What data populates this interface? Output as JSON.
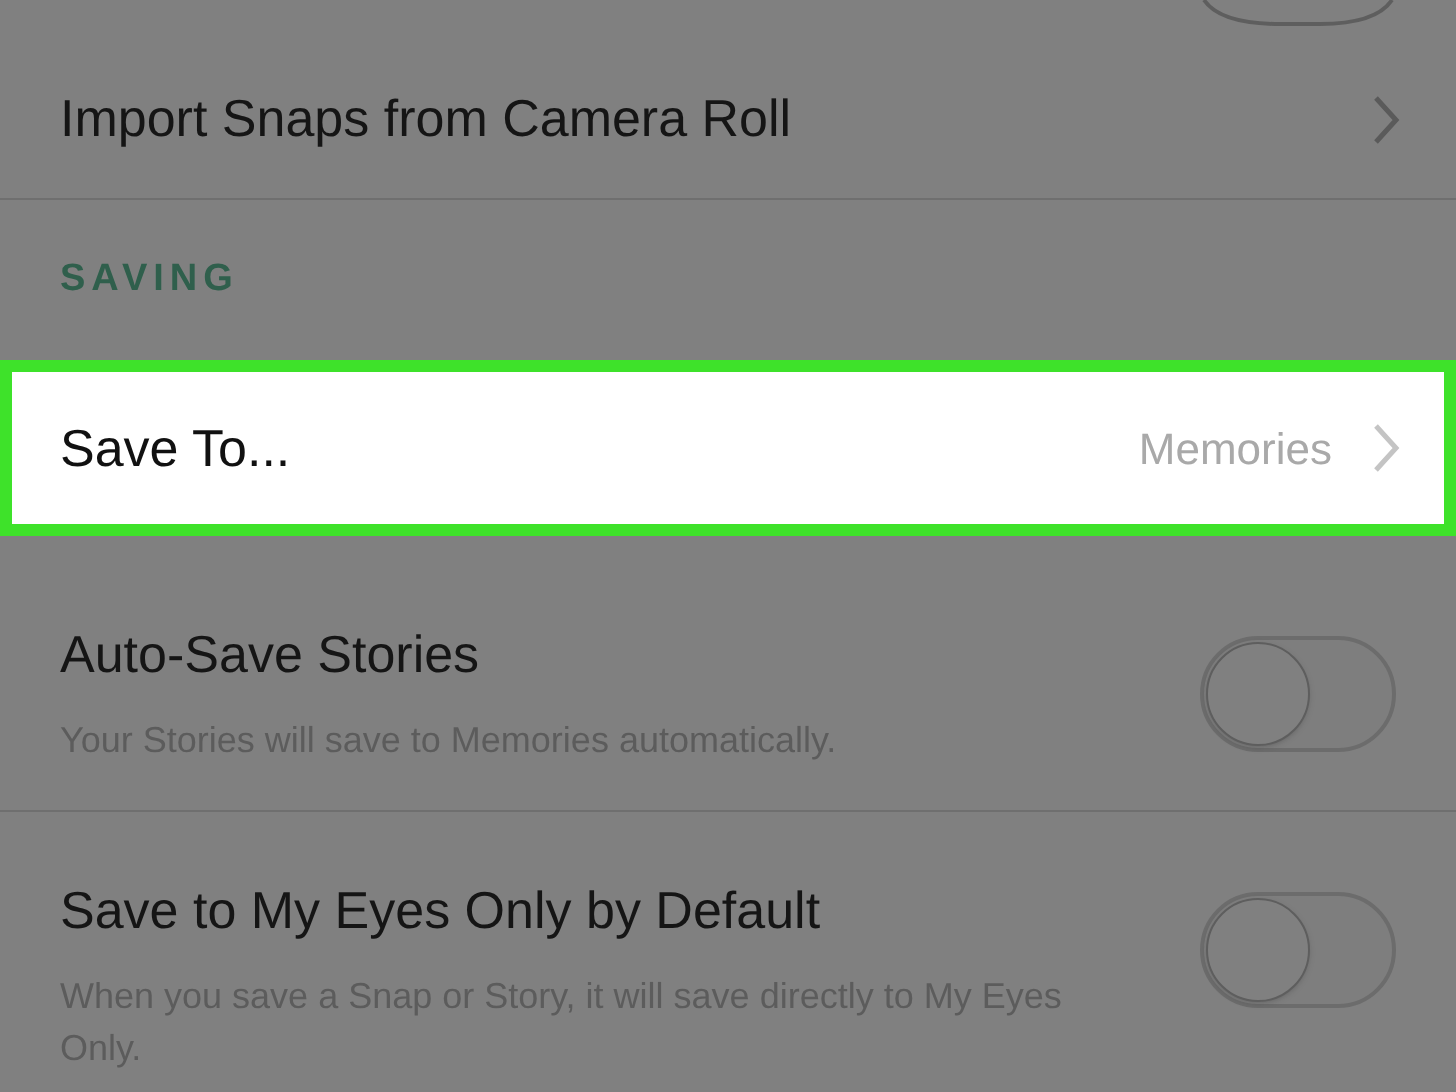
{
  "rows": [
    {
      "kind": "link",
      "title": "Import Snaps from Camera Roll"
    }
  ],
  "section": {
    "header": "SAVING"
  },
  "highlighted": {
    "title": "Save To...",
    "value": "Memories"
  },
  "toggles": [
    {
      "title": "Auto-Save Stories",
      "description": "Your Stories will save to Memories automatically.",
      "on": false
    },
    {
      "title": "Save to My Eyes Only by Default",
      "description": "When you save a Snap or Story, it will save directly to My Eyes Only.",
      "on": false
    }
  ]
}
